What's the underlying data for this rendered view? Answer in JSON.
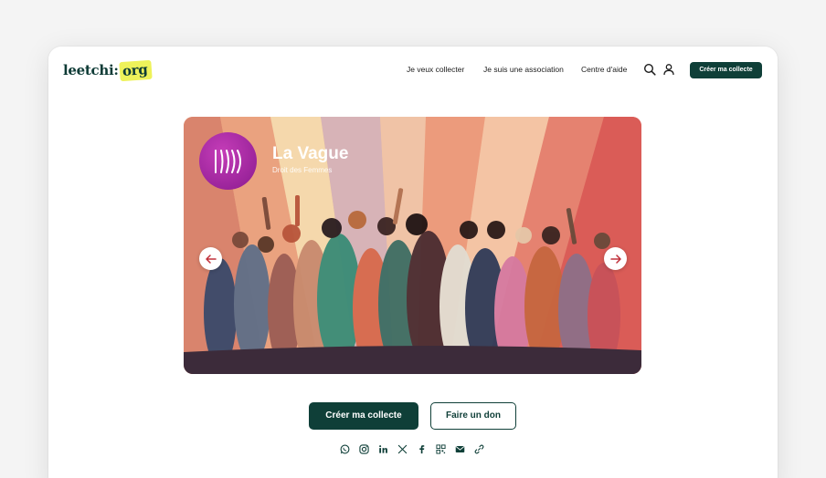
{
  "brand": {
    "logo_main": "leetchi",
    "logo_colon": ":",
    "logo_org": "org"
  },
  "nav": {
    "links": [
      "Je veux collecter",
      "Je suis une association",
      "Centre d'aide"
    ],
    "cta": "Créer ma collecte"
  },
  "hero": {
    "title": "La Vague",
    "subtitle": "Droit des Femmes"
  },
  "actions": {
    "primary": "Créer ma collecte",
    "secondary": "Faire un don"
  },
  "share": [
    "whatsapp-icon",
    "instagram-icon",
    "linkedin-icon",
    "x-icon",
    "facebook-icon",
    "qr-code-icon",
    "email-icon",
    "link-icon"
  ],
  "colors": {
    "brand_green": "#0f3f38",
    "logo_highlight": "#eef25a",
    "avatar_purple": "#b12fa8"
  }
}
